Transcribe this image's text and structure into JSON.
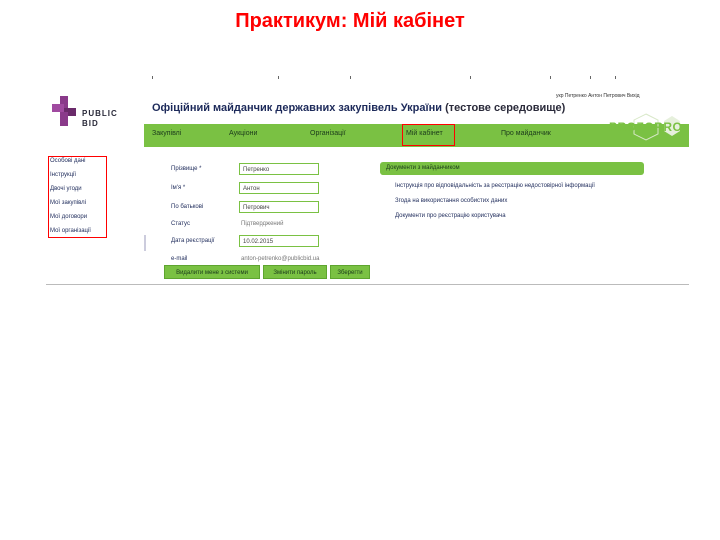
{
  "slide": {
    "title": "Практикум: Мій кабінет"
  },
  "site": {
    "logo_line1": "PUBLIC",
    "logo_line2": "BID",
    "title": "Офіційний майданчик державних закупівель України",
    "title_suffix": "(тестове середовище)",
    "user_link": "укр Петренко Антон Петрович Вихід",
    "prozorro": "PROZORRO"
  },
  "nav": [
    {
      "label": "Закупівлі"
    },
    {
      "label": "Аукціони"
    },
    {
      "label": "Організації"
    },
    {
      "label": "Мій кабінет"
    },
    {
      "label": "Про майданчик"
    }
  ],
  "sidebar": [
    {
      "label": "Особові дані"
    },
    {
      "label": "Інструкції"
    },
    {
      "label": "Двочі угоди"
    },
    {
      "label": "Мої закупівлі"
    },
    {
      "label": "Мої договори"
    },
    {
      "label": "Мої організації"
    }
  ],
  "form": {
    "surname_label": "Прізвище *",
    "surname_value": "Петренко",
    "name_label": "Ім'я *",
    "name_value": "Антон",
    "patronymic_label": "По батькові",
    "patronymic_value": "Петрович",
    "status_label": "Статус",
    "status_value": "Підтверджений",
    "date_label": "Дата реєстрації",
    "date_value": "10.02.2015",
    "email_label": "e-mail",
    "email_value": "anton-petrenko@publicbid.ua"
  },
  "buttons": {
    "logout_all": "Видалити мене з системи",
    "change_password": "Змінити пароль",
    "save": "Зберегти"
  },
  "documents": {
    "header": "Документи з майданчиком",
    "items": [
      "Інструкція про відповідальність за реєстрацію недостовірної інформації",
      "Згода на використання особистих даних",
      "Документи про реєстрацію користувача"
    ]
  },
  "colors": {
    "accent": "#7ac143",
    "highlight": "#ff0000",
    "title": "#ff0000"
  }
}
